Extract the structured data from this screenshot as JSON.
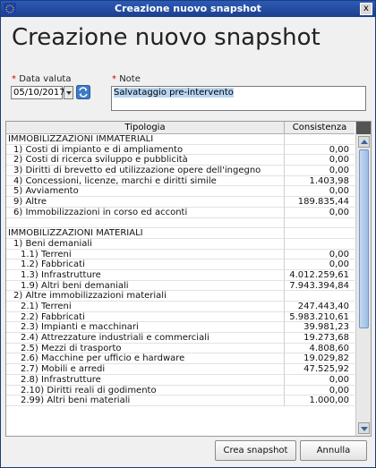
{
  "window": {
    "title": "Creazione nuovo snapshot",
    "close_glyph": "x"
  },
  "page": {
    "heading": "Creazione nuovo snapshot"
  },
  "form": {
    "date_required_mark": "*",
    "date_label": "Data valuta",
    "date_value": "05/10/2017",
    "note_required_mark": "*",
    "note_label": "Note",
    "note_value": "Salvataggio pre-intervento"
  },
  "table": {
    "columns": [
      "Tipologia",
      "Consistenza"
    ],
    "rows": [
      {
        "label": "IMMOBILIZZAZIONI IMMATERIALI",
        "value": ""
      },
      {
        "label": "1) Costi di impianto e di ampliamento",
        "value": "0,00"
      },
      {
        "label": "2) Costi di ricerca sviluppo e pubblicità",
        "value": "0,00"
      },
      {
        "label": "3) Diritti di brevetto ed utilizzazione opere dell'ingegno",
        "value": "0,00"
      },
      {
        "label": "4) Concessioni, licenze, marchi e diritti simile",
        "value": "1.403,98"
      },
      {
        "label": "5) Avviamento",
        "value": "0,00"
      },
      {
        "label": "9) Altre",
        "value": "189.835,44"
      },
      {
        "label": "6) Immobilizzazioni in corso ed acconti",
        "value": "0,00"
      },
      {
        "label": "",
        "value": ""
      },
      {
        "label": "IMMOBILIZZAZIONI MATERIALI",
        "value": ""
      },
      {
        "label": "1) Beni demaniali",
        "value": ""
      },
      {
        "label": "1.1) Terreni",
        "value": "0,00"
      },
      {
        "label": "1.2) Fabbricati",
        "value": "0,00"
      },
      {
        "label": "1.3) Infrastrutture",
        "value": "4.012.259,61"
      },
      {
        "label": "1.9) Altri beni demaniali",
        "value": "7.943.394,84"
      },
      {
        "label": "2) Altre immobilizzazioni materiali",
        "value": ""
      },
      {
        "label": "2.1) Terreni",
        "value": "247.443,40"
      },
      {
        "label": "2.2) Fabbricati",
        "value": "5.983.210,61"
      },
      {
        "label": "2.3) Impianti e macchinari",
        "value": "39.981,23"
      },
      {
        "label": "2.4) Attrezzature industriali e commerciali",
        "value": "19.273,68"
      },
      {
        "label": "2.5) Mezzi di trasporto",
        "value": "4.808,60"
      },
      {
        "label": "2.6) Macchine per ufficio e hardware",
        "value": "19.029,82"
      },
      {
        "label": "2.7) Mobili e arredi",
        "value": "47.525,92"
      },
      {
        "label": "2.8) Infrastrutture",
        "value": "0,00"
      },
      {
        "label": "2.10) Diritti reali di godimento",
        "value": "0,00"
      },
      {
        "label": "2.99) Altri beni materiali",
        "value": "1.000,00"
      }
    ],
    "indent_levels": [
      0,
      1,
      1,
      1,
      1,
      1,
      1,
      1,
      0,
      0,
      1,
      2,
      2,
      2,
      2,
      1,
      2,
      2,
      2,
      2,
      2,
      2,
      2,
      2,
      2,
      2
    ]
  },
  "buttons": {
    "create_label": "Crea snapshot",
    "cancel_label": "Annulla"
  },
  "colors": {
    "titlebar": "#1c3f8c",
    "scroll_thumb": "#9cbde3",
    "required_mark": "#d40000",
    "note_selection": "#b8d5f2"
  },
  "icons": [
    "app-icon",
    "close-icon",
    "refresh-icon",
    "dropdown-arrow-icon",
    "scroll-up-icon",
    "scroll-down-icon"
  ]
}
